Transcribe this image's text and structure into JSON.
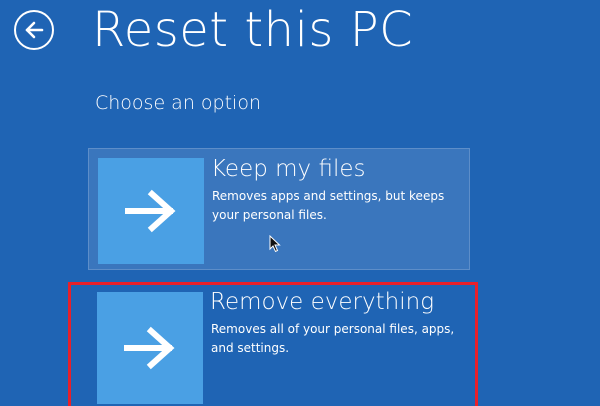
{
  "header": {
    "back_icon": "back-arrow-icon",
    "title": "Reset this PC"
  },
  "main": {
    "subtitle": "Choose an option",
    "options": [
      {
        "title": "Keep my files",
        "description": "Removes apps and settings, but keeps your personal files.",
        "icon": "arrow-right-icon"
      },
      {
        "title": "Remove everything",
        "description": "Removes all of your personal files, apps, and settings.",
        "icon": "arrow-right-icon"
      }
    ]
  },
  "colors": {
    "background": "#1f64b4",
    "tile": "#4aa0e4",
    "highlight_frame": "#e8202a",
    "text": "#ffffff"
  },
  "overlay": {
    "cursor_icon": "mouse-pointer-icon"
  }
}
